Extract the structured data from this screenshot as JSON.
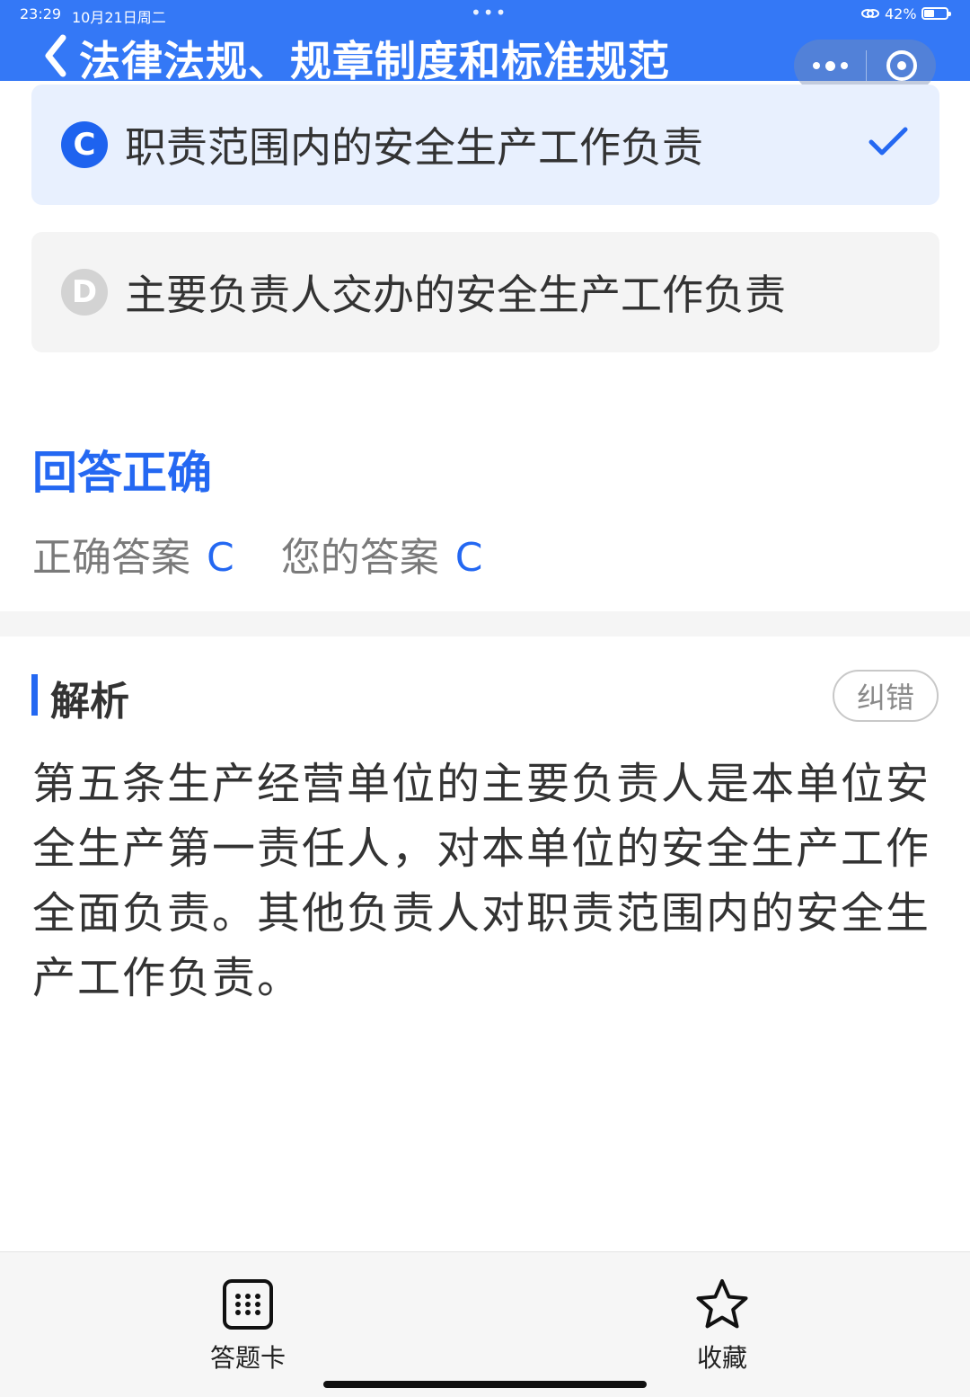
{
  "status_bar": {
    "time": "23:29",
    "date": "10月21日周二",
    "dots": "•••",
    "battery": "42%"
  },
  "header": {
    "title": "法律法规、规章制度和标准规范",
    "back_icon": "chevron-left-icon",
    "more_icon": "more-dots-icon",
    "close_icon": "target-close-icon"
  },
  "options": [
    {
      "letter": "C",
      "text": "职责范围内的安全生产工作负责",
      "selected": true
    },
    {
      "letter": "D",
      "text": "主要负责人交办的安全生产工作负责",
      "selected": false
    }
  ],
  "result": {
    "title": "回答正确",
    "correct_label": "正确答案",
    "correct_value": "C",
    "your_label": "您的答案",
    "your_value": "C"
  },
  "analysis": {
    "title": "解析",
    "report_label": "纠错",
    "text": "第五条生产经营单位的主要负责人是本单位安全生产第一责任人，对本单位的安全生产工作全面负责。其他负责人对职责范围内的安全生产工作负责。"
  },
  "bottom_bar": {
    "answer_card_label": "答题卡",
    "favorite_label": "收藏"
  },
  "colors": {
    "accent": "#2468f2",
    "header": "#3478f6",
    "selected_bg": "#e8f0fe"
  }
}
